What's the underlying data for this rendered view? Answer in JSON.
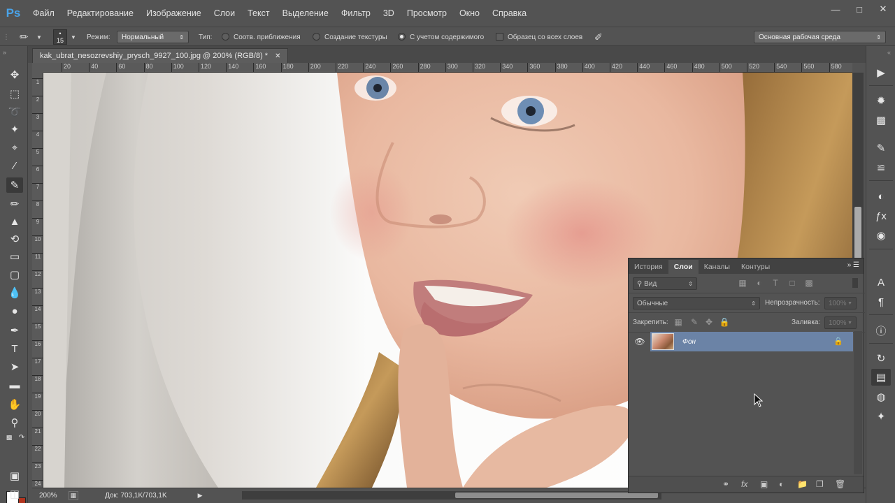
{
  "app": {
    "logo": "Ps"
  },
  "menu": [
    "Файл",
    "Редактирование",
    "Изображение",
    "Слои",
    "Текст",
    "Выделение",
    "Фильтр",
    "3D",
    "Просмотр",
    "Окно",
    "Справка"
  ],
  "options": {
    "brush_size": "15",
    "mode_label": "Режим:",
    "mode_value": "Нормальный",
    "type_label": "Тип:",
    "type_options": [
      "Соотв. приближения",
      "Создание текстуры",
      "С учетом содержимого"
    ],
    "type_selected_index": 2,
    "sample_all_label": "Образец со всех слоев",
    "workspace": "Основная рабочая среда"
  },
  "document": {
    "tab_title": "kak_ubrat_nesozrevshiy_prysch_9927_100.jpg @ 200% (RGB/8) *",
    "ruler_h": [
      "20",
      "40",
      "60",
      "80",
      "100",
      "120",
      "140",
      "160",
      "180",
      "200",
      "220",
      "240",
      "260",
      "280",
      "300",
      "320",
      "340",
      "360",
      "380",
      "400",
      "420",
      "440",
      "460",
      "480",
      "500",
      "520",
      "540",
      "560",
      "580"
    ],
    "ruler_v": [
      "1",
      "2",
      "3",
      "4",
      "5",
      "6",
      "7",
      "8",
      "9",
      "10",
      "11",
      "12",
      "13",
      "14",
      "15",
      "16",
      "17",
      "18",
      "19",
      "20",
      "21",
      "22",
      "23",
      "24"
    ],
    "zoom": "200%",
    "doc_size": "Док: 703,1K/703,1K"
  },
  "layers_panel": {
    "tabs": [
      "История",
      "Слои",
      "Каналы",
      "Контуры"
    ],
    "active_tab_index": 1,
    "filter_kind": "Вид",
    "blend_mode": "Обычные",
    "opacity_label": "Непрозрачность:",
    "opacity_value": "100%",
    "lock_label": "Закрепить:",
    "fill_label": "Заливка:",
    "fill_value": "100%",
    "layers": [
      {
        "name": "Фон",
        "visible": true,
        "locked": true
      }
    ]
  },
  "colors": {
    "foreground": "#ffffff",
    "background": "#b2341e",
    "selected_layer": "#6b83a6"
  }
}
